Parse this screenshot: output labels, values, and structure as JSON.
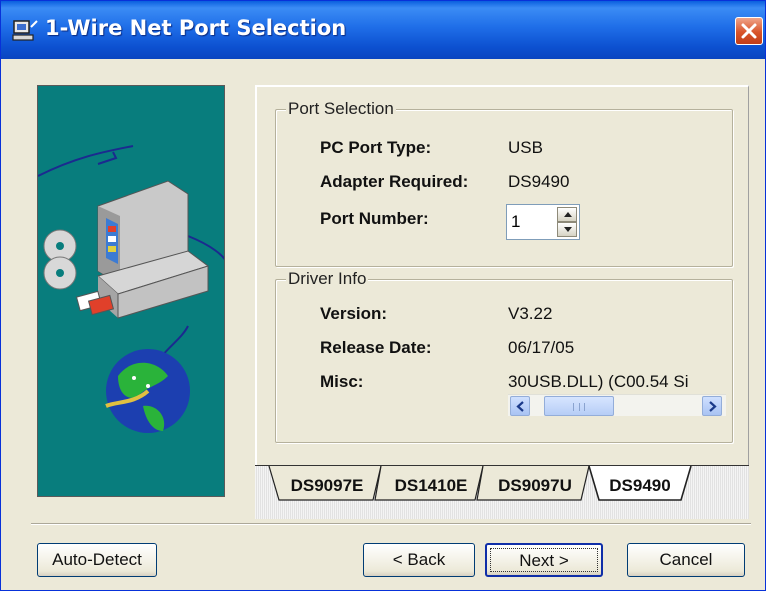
{
  "window": {
    "title": "1-Wire Net Port Selection",
    "icon": "computer-wire-icon",
    "close_icon": "close-icon"
  },
  "port_selection": {
    "legend": "Port Selection",
    "pc_port_type_label": "PC Port Type:",
    "pc_port_type_value": "USB",
    "adapter_required_label": "Adapter Required:",
    "adapter_required_value": "DS9490",
    "port_number_label": "Port Number:",
    "port_number_value": "1"
  },
  "driver_info": {
    "legend": "Driver Info",
    "version_label": "Version:",
    "version_value": "V3.22",
    "release_date_label": "Release Date:",
    "release_date_value": "06/17/05",
    "misc_label": "Misc:",
    "misc_value": "30USB.DLL) (C00.54 Si"
  },
  "tabs": [
    {
      "label": "DS9097E",
      "selected": false
    },
    {
      "label": "DS1410E",
      "selected": false
    },
    {
      "label": "DS9097U",
      "selected": false
    },
    {
      "label": "DS9490",
      "selected": true
    }
  ],
  "buttons": {
    "auto_detect": "Auto-Detect",
    "back": "< Back",
    "next": "Next >",
    "cancel": "Cancel"
  },
  "colors": {
    "titlebar": "#0a5fde",
    "side_image_bg": "#087d7d",
    "dialog_bg": "#ece9d8"
  }
}
